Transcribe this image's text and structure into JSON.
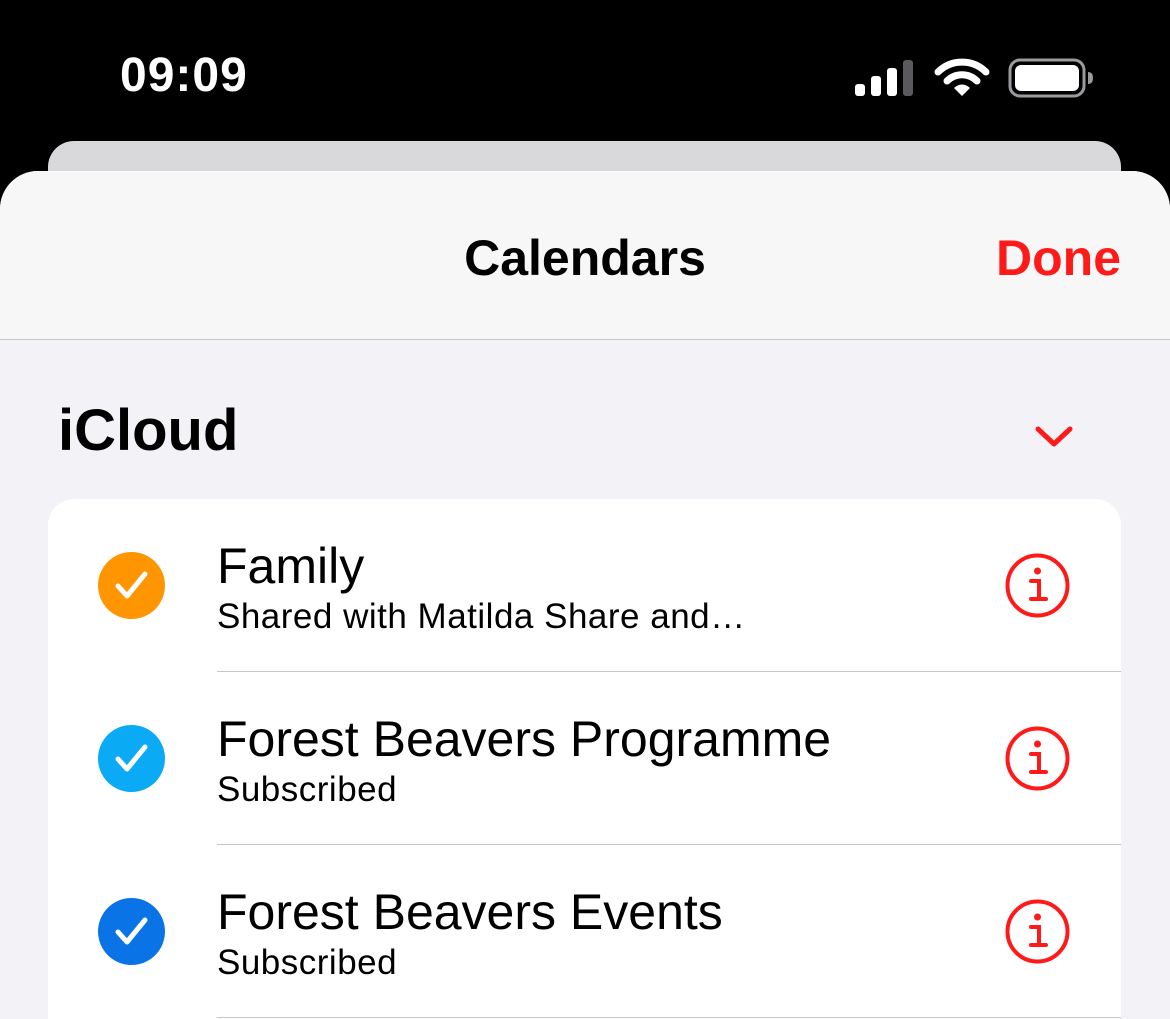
{
  "status_bar": {
    "time": "09:09"
  },
  "nav": {
    "title": "Calendars",
    "done_label": "Done"
  },
  "section": {
    "title": "iCloud"
  },
  "calendars": [
    {
      "name": "Family",
      "subtitle": "Shared with Matilda Share and…",
      "color": "#ff9500"
    },
    {
      "name": "Forest Beavers Programme",
      "subtitle": "Subscribed",
      "color": "#0aaaf5"
    },
    {
      "name": "Forest Beavers Events",
      "subtitle": "Subscribed",
      "color": "#0a74e6"
    }
  ],
  "colors": {
    "accent": "#ff1a1a",
    "background": "#f2f2f7",
    "card": "#ffffff"
  },
  "icons": {
    "signal": "cellular-signal-icon",
    "wifi": "wifi-icon",
    "battery": "battery-icon",
    "chevron": "chevron-down-icon",
    "check": "checkmark-icon",
    "info": "info-icon"
  }
}
